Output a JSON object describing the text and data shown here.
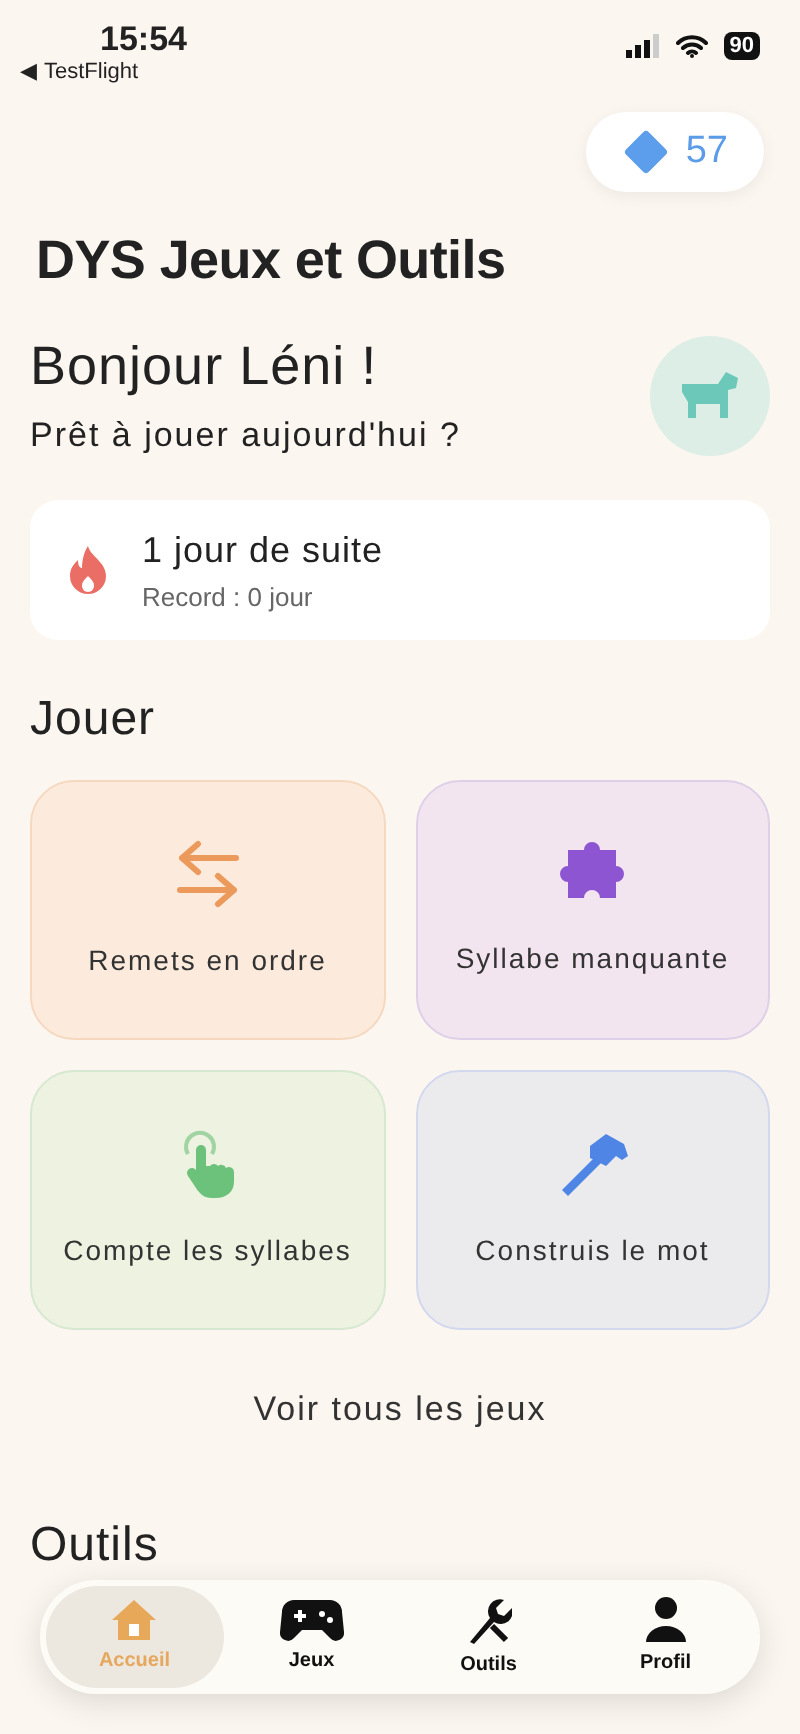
{
  "status_bar": {
    "time": "15:54",
    "back_arrow": "◀",
    "back_label": "TestFlight",
    "battery": "90"
  },
  "gems": {
    "count": "57"
  },
  "app_title": "DYS Jeux et Outils",
  "greeting": {
    "title": "Bonjour Léni !",
    "subtitle": "Prêt à jouer aujourd'hui ?"
  },
  "streak": {
    "title": "1 jour de suite",
    "record": "Record : 0 jour"
  },
  "play_section": {
    "heading": "Jouer",
    "games": [
      {
        "label": "Remets en ordre",
        "color": "#ec9a5c"
      },
      {
        "label": "Syllabe manquante",
        "color": "#8e55d3"
      },
      {
        "label": "Compte les syllabes",
        "color": "#6cc27a"
      },
      {
        "label": "Construis le mot",
        "color": "#4f86e6"
      }
    ],
    "see_all": "Voir tous les jeux"
  },
  "tools_section": {
    "heading": "Outils"
  },
  "tab_bar": [
    {
      "label": "Accueil",
      "selected": true
    },
    {
      "label": "Jeux",
      "selected": false
    },
    {
      "label": "Outils",
      "selected": false
    },
    {
      "label": "Profil",
      "selected": false
    }
  ]
}
